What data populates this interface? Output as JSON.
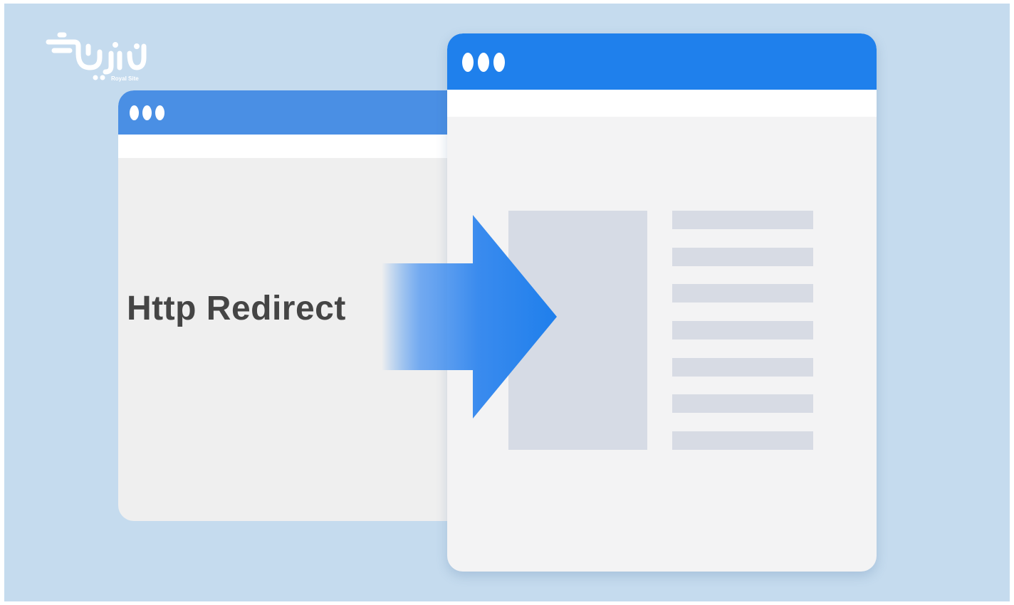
{
  "logo": {
    "wordmark": "رویال سایت",
    "subtitle": "Royal Site"
  },
  "headline": "Http Redirect",
  "back_window": {
    "dots": 3
  },
  "front_window": {
    "dots": 3,
    "content_lines": 7
  },
  "colors": {
    "background": "#c5dbee",
    "front_titlebar": "#1f80ec",
    "back_titlebar": "#4a8fe4",
    "arrow": "#2b86ef",
    "window_body": "#f3f3f4",
    "placeholder": "#d6dbe5",
    "headline": "#454545"
  },
  "icons": {
    "arrow": "redirect-arrow-icon",
    "dots": "window-dots-icon"
  }
}
